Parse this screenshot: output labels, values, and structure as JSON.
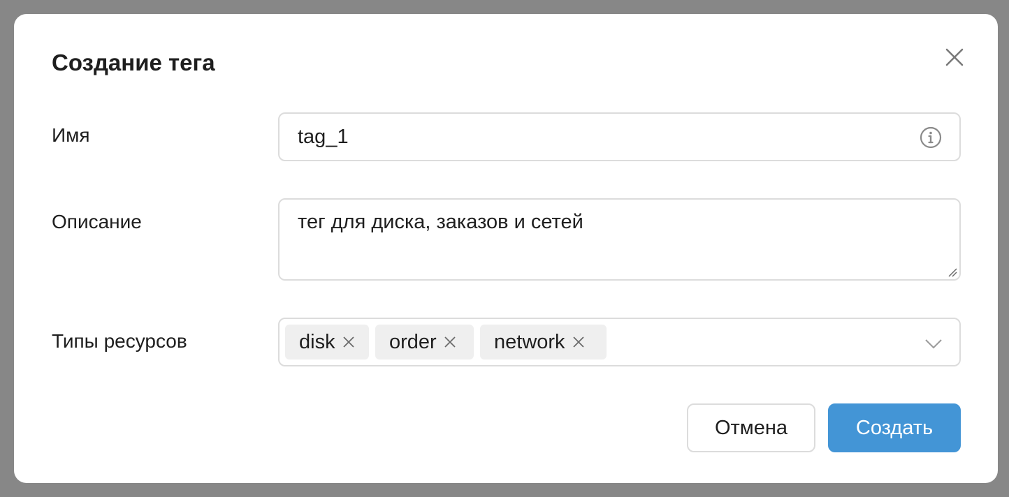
{
  "dialog": {
    "title": "Создание тега",
    "close_icon": "close-icon"
  },
  "fields": {
    "name": {
      "label": "Имя",
      "value": "tag_1",
      "icon": "info-icon"
    },
    "description": {
      "label": "Описание",
      "value": "тег для диска, заказов и сетей"
    },
    "resource_types": {
      "label": "Типы ресурсов",
      "selected": [
        "disk",
        "order",
        "network"
      ],
      "icon": "chevron-down-icon"
    }
  },
  "buttons": {
    "cancel_label": "Отмена",
    "create_label": "Создать"
  },
  "colors": {
    "overlay": "#878787",
    "primary": "#4395d6",
    "chip_bg": "#efefef",
    "border": "#dcdcdc"
  }
}
